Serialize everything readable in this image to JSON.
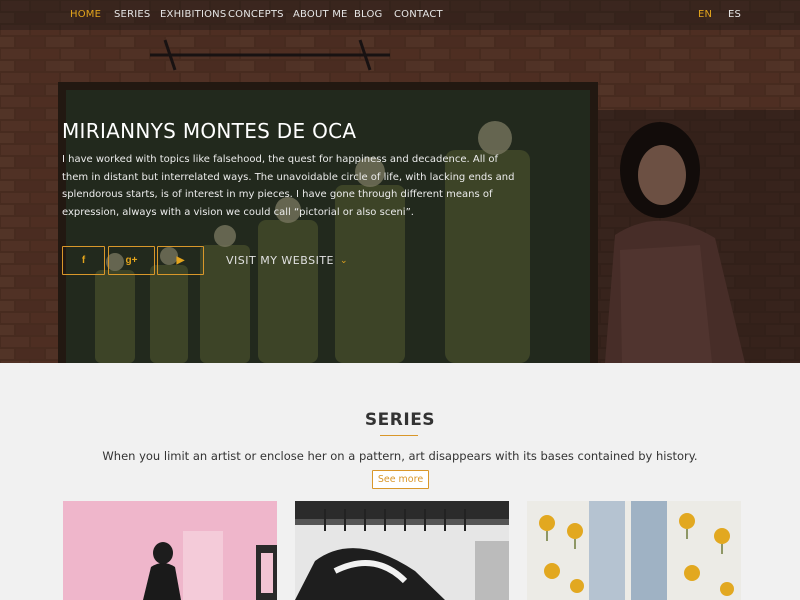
{
  "nav": {
    "items": [
      {
        "label": "HOME",
        "active": true
      },
      {
        "label": "SERIES",
        "active": false
      },
      {
        "label": "EXHIBITIONS",
        "active": false
      },
      {
        "label": "CONCEPTS",
        "active": false
      },
      {
        "label": "ABOUT ME",
        "active": false
      },
      {
        "label": "BLOG",
        "active": false
      },
      {
        "label": "CONTACT",
        "active": false
      }
    ],
    "languages": [
      {
        "label": "EN",
        "active": true
      },
      {
        "label": "ES",
        "active": false
      }
    ]
  },
  "hero": {
    "title": "MIRIANNYS MONTES DE OCA",
    "text": "I have worked with topics like falsehood, the quest for happiness and decadence. All of them in distant but interrelated ways. The unavoidable circle of life, with lacking ends and splendorous starts, is of interest in my pieces. I have gone through different means of expression, always with a vision we could call “pictorial or also sceni”.",
    "social": [
      {
        "icon": "facebook-icon",
        "glyph": "f"
      },
      {
        "icon": "google-plus-icon",
        "glyph": "g+"
      },
      {
        "icon": "youtube-icon",
        "glyph": "▶"
      }
    ],
    "visit_label": "VISIT MY WEBSITE",
    "visit_chevron": "⌄"
  },
  "series": {
    "title": "SERIES",
    "subtitle": "When you limit an artist or enclose her on a pattern, art disappears with its bases contained by history.",
    "see_more": "See more"
  },
  "colors": {
    "accent": "#e3a41c",
    "nav_text": "#e6e6e6",
    "section_bg": "#f1f1f1"
  }
}
